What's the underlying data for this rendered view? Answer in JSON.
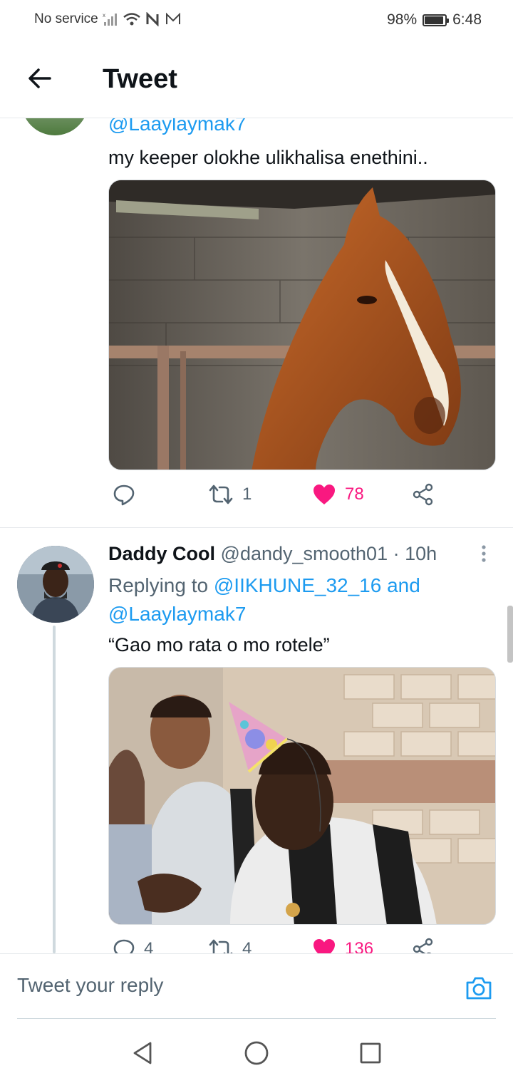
{
  "status": {
    "carrier": "No service",
    "battery": "98%",
    "time": "6:48"
  },
  "header": {
    "title": "Tweet"
  },
  "tweets": [
    {
      "replying_handle": "@Laaylaymak7",
      "text": "my keeper olokhe ulikhalisa enethini..",
      "media_alt": "horse in stable",
      "replies": "",
      "retweets": "1",
      "likes": "78"
    },
    {
      "name": "Daddy Cool",
      "handle": "@dandy_smooth01",
      "time": "· 10h",
      "replying_prefix": "Replying to",
      "replying_to_1": "@IIKHUNE_32_16",
      "replying_and": "and",
      "replying_to_2": "@Laaylaymak7",
      "text": "“Gao mo rata o mo rotele”",
      "media_alt": "man with party hat",
      "replies": "4",
      "retweets": "4",
      "likes": "136"
    }
  ],
  "reply": {
    "placeholder": "Tweet your reply"
  },
  "colors": {
    "link": "#1d9bf0",
    "like": "#f91880",
    "muted": "#536471"
  }
}
